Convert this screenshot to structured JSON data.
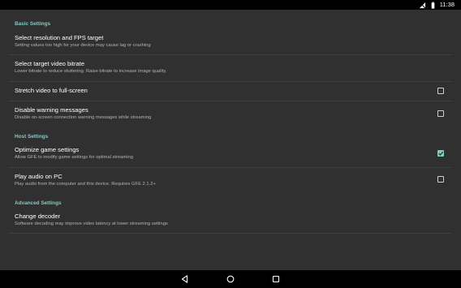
{
  "status_bar": {
    "time": "11:38",
    "icons": [
      "no-sim-icon",
      "battery-icon"
    ]
  },
  "sections": {
    "basic": "Basic Settings",
    "host": "Host Settings",
    "advanced": "Advanced Settings"
  },
  "prefs": {
    "resolution": {
      "title": "Select resolution and FPS target",
      "summary": "Setting values too high for your device may cause lag or crashing"
    },
    "bitrate": {
      "title": "Select target video bitrate",
      "summary": "Lower bitrate to reduce stuttering. Raise bitrate to increase image quality."
    },
    "stretch": {
      "title": "Stretch video to full-screen",
      "checked": false
    },
    "warnings": {
      "title": "Disable warning messages",
      "summary": "Disable on-screen connection warning messages while streaming",
      "checked": false
    },
    "optimize": {
      "title": "Optimize game settings",
      "summary": "Allow GFE to modify game settings for optimal streaming",
      "checked": true
    },
    "audio": {
      "title": "Play audio on PC",
      "summary": "Play audio from the computer and this device. Requires GFE 2.1.2+",
      "checked": false
    },
    "decoder": {
      "title": "Change decoder",
      "summary": "Software decoding may improve video latency at lower streaming settings"
    }
  },
  "nav_bar": {
    "icons": [
      "back-icon",
      "home-icon",
      "recents-icon"
    ]
  },
  "colors": {
    "background": "#303030",
    "accent": "#80cbc4",
    "bars": "#000000"
  }
}
